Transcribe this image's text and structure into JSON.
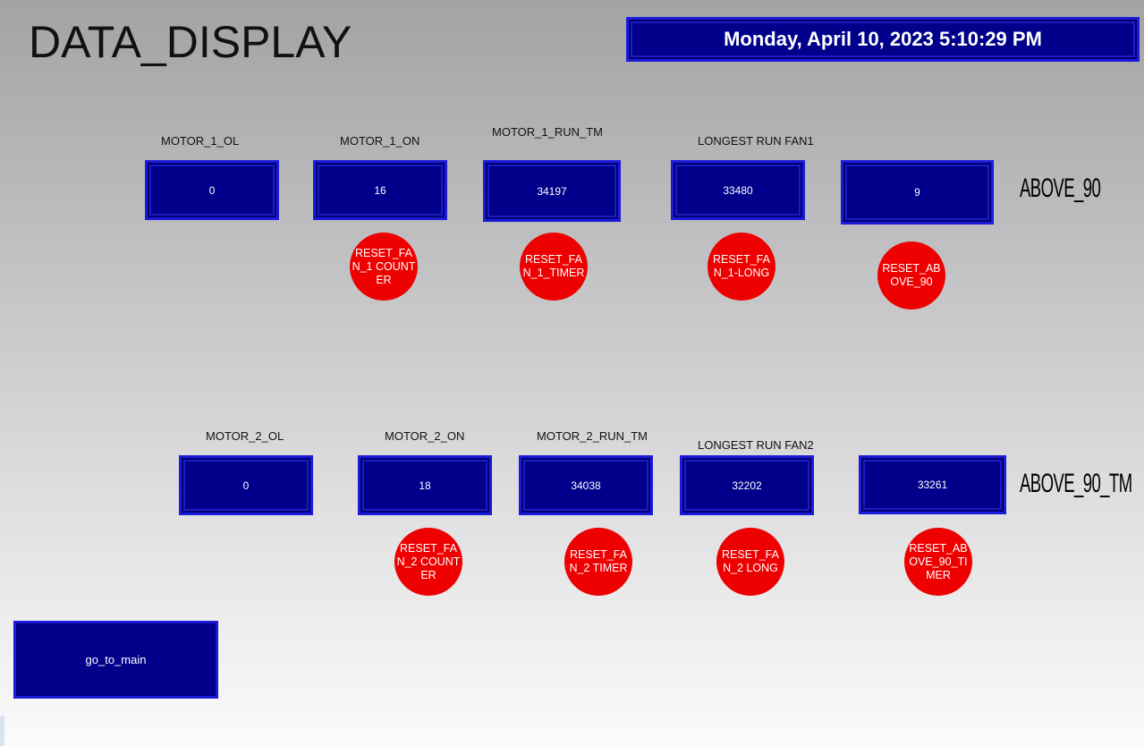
{
  "page": {
    "title": "DATA_DISPLAY",
    "datetime": "Monday, April 10, 2023 5:10:29 PM"
  },
  "fan1": {
    "labels": {
      "ol": "MOTOR_1_OL",
      "on": "MOTOR_1_ON",
      "run_tm": "MOTOR_1_RUN_TM",
      "longest": "LONGEST RUN FAN1",
      "above": "ABOVE_90"
    },
    "values": {
      "ol": "0",
      "on": "16",
      "run_tm": "34197",
      "longest": "33480",
      "above": "9"
    },
    "resets": {
      "counter": "RESET_FAN_1 COUNTER",
      "timer": "RESET_FAN_1_TIMER",
      "long": "RESET_FAN_1-LONG",
      "above": "RESET_ABOVE_90"
    }
  },
  "fan2": {
    "labels": {
      "ol": "MOTOR_2_OL",
      "on": "MOTOR_2_ON",
      "run_tm": "MOTOR_2_RUN_TM",
      "longest": "LONGEST RUN FAN2",
      "above": "ABOVE_90_TM"
    },
    "values": {
      "ol": "0",
      "on": "18",
      "run_tm": "34038",
      "longest": "32202",
      "above": "33261"
    },
    "resets": {
      "counter": "RESET_FAN_2 COUNTER",
      "timer": "RESET_FAN_2 TIMER",
      "long": "RESET_FAN_2 LONG",
      "above": "RESET_ABOVE_90_TIMER"
    }
  },
  "nav": {
    "main_button": "go_to_main"
  }
}
